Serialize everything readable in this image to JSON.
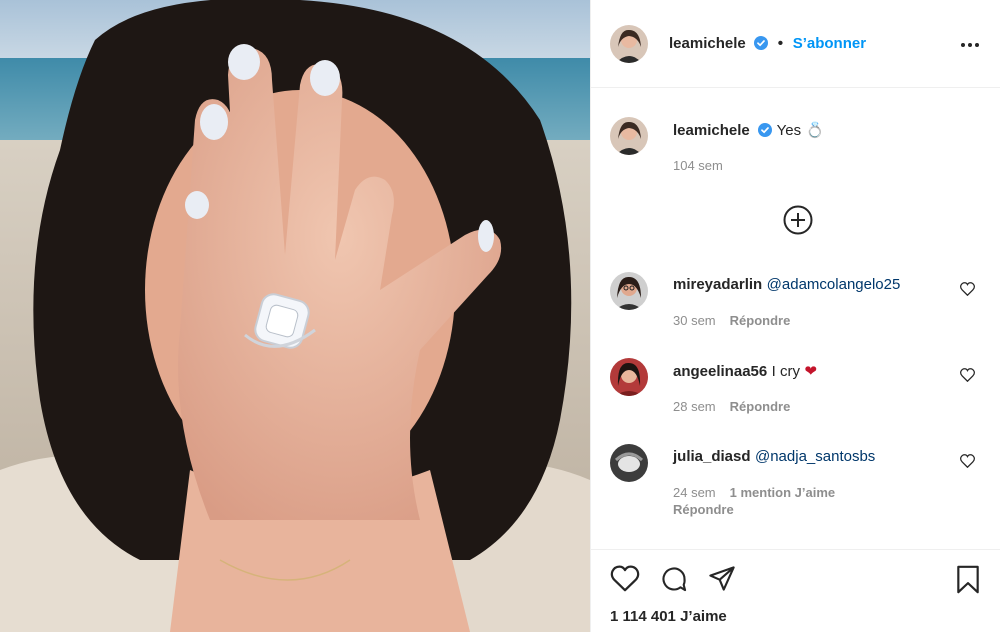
{
  "header": {
    "username": "leamichele",
    "follow_label": "S’abonner",
    "separator": "•"
  },
  "caption": {
    "username": "leamichele",
    "text": "Yes",
    "emoji": "💍",
    "time": "104 sem"
  },
  "comments": [
    {
      "username": "mireyadarlin",
      "mention": "@adamcolangelo25",
      "text": "",
      "time": "30 sem",
      "likes": "",
      "reply_label": "Répondre"
    },
    {
      "username": "angeelinaa56",
      "mention": "",
      "text": "I cry",
      "emoji": "❤",
      "time": "28 sem",
      "likes": "",
      "reply_label": "Répondre"
    },
    {
      "username": "julia_diasd",
      "mention": "@nadja_santosbs",
      "text": "",
      "time": "24 sem",
      "likes": "1 mention J’aime",
      "reply_label": "Répondre"
    }
  ],
  "footer": {
    "likes_count": "1 114 401 J’aime"
  },
  "colors": {
    "link": "#0095f6",
    "mention": "#00376b",
    "meta": "#8e8e8e",
    "border": "#efefef",
    "heart": "#c4142b"
  },
  "icons": [
    "verified-icon",
    "more-options-icon",
    "add-circle-icon",
    "heart-icon",
    "comment-icon",
    "share-icon",
    "bookmark-icon"
  ]
}
